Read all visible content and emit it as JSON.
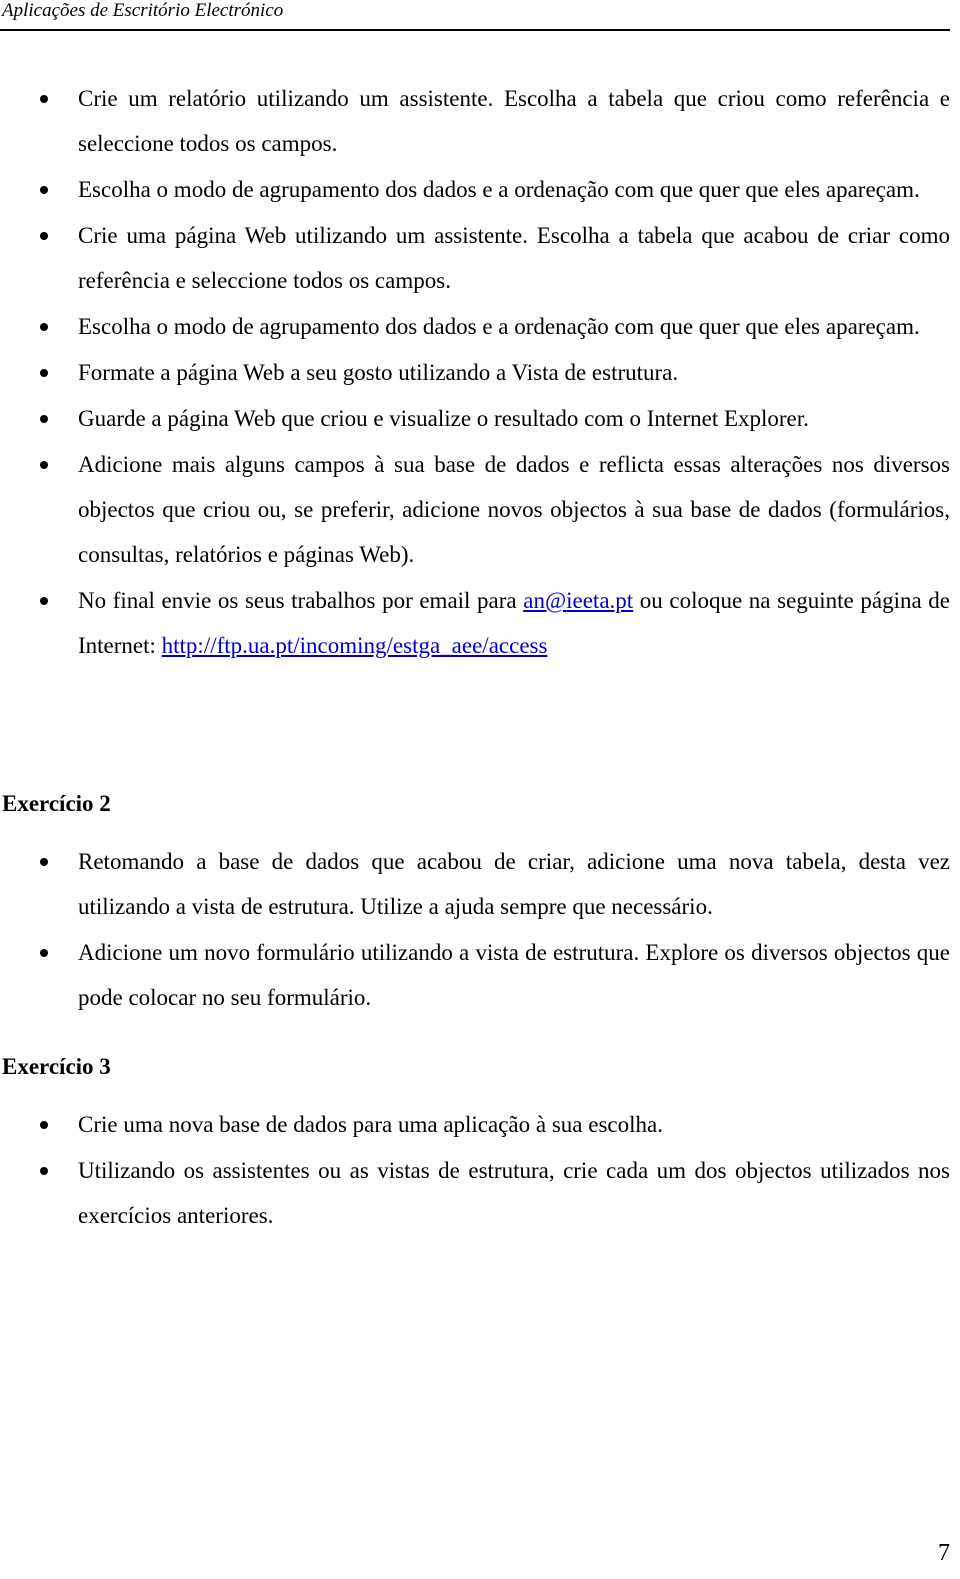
{
  "header": {
    "title": "Aplicações de Escritório Electrónico"
  },
  "list1": {
    "items": [
      "Crie um relatório utilizando um assistente. Escolha a tabela que criou como referência e seleccione todos os campos.",
      "Escolha o modo de agrupamento dos dados e a ordenação com que quer que eles apareçam.",
      "Crie uma página Web utilizando um assistente. Escolha a tabela que acabou de criar como referência e seleccione todos os campos.",
      "Escolha o modo de agrupamento dos dados e a ordenação com que quer que eles apareçam.",
      "Formate a página Web a seu gosto utilizando a Vista de estrutura.",
      "Guarde a página Web que criou e visualize o resultado com o Internet Explorer.",
      "Adicione mais alguns campos à sua base de dados e reflicta essas alterações nos diversos objectos que criou ou, se preferir, adicione novos objectos à sua base de dados (formulários, consultas, relatórios e páginas Web)."
    ],
    "last_item": {
      "text_before": "No final envie os seus trabalhos por email para ",
      "email": "an@ieeta.pt",
      "text_middle": " ou coloque na seguinte página de Internet: ",
      "url": "http://ftp.ua.pt/incoming/estga_aee/access"
    }
  },
  "exercise2": {
    "heading": "Exercício 2",
    "items": [
      "Retomando a base de dados que acabou de criar, adicione uma nova tabela, desta vez utilizando a vista de estrutura. Utilize a ajuda sempre que necessário.",
      "Adicione um novo formulário utilizando a vista de estrutura. Explore os diversos objectos que pode colocar no seu formulário."
    ]
  },
  "exercise3": {
    "heading": "Exercício 3",
    "items": [
      "Crie uma nova base de dados para uma aplicação à sua escolha.",
      "Utilizando os assistentes ou as vistas de estrutura, crie cada um dos objectos utilizados nos exercícios anteriores."
    ]
  },
  "footer": {
    "page_number": "7"
  },
  "colors": {
    "link": "#0000cc"
  }
}
